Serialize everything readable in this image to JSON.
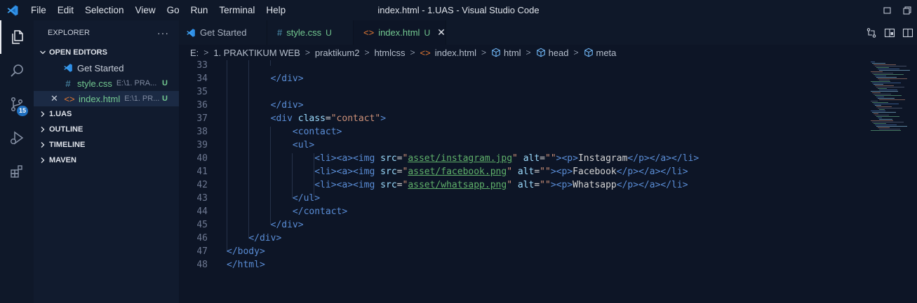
{
  "titlebar": {
    "menu": [
      "File",
      "Edit",
      "Selection",
      "View",
      "Go",
      "Run",
      "Terminal",
      "Help"
    ],
    "title": "index.html - 1.UAS - Visual Studio Code"
  },
  "activitybar": {
    "items": [
      "explorer",
      "search",
      "source-control",
      "run-debug",
      "extensions"
    ],
    "scm_badge": "15"
  },
  "sidebar": {
    "title": "EXPLORER",
    "more": "···",
    "open_editors_label": "OPEN EDITORS",
    "open_editors": [
      {
        "name": "Get Started",
        "path": "",
        "status": ""
      },
      {
        "name": "style.css",
        "path": "E:\\1. PRA...",
        "status": "U"
      },
      {
        "name": "index.html",
        "path": "E:\\1. PR...",
        "status": "U"
      }
    ],
    "sections": [
      "1.UAS",
      "OUTLINE",
      "TIMELINE",
      "MAVEN"
    ]
  },
  "tabs": [
    {
      "label": "Get Started",
      "status": ""
    },
    {
      "label": "style.css",
      "status": "U"
    },
    {
      "label": "index.html",
      "status": "U"
    }
  ],
  "breadcrumbs": [
    "E:",
    "1. PRAKTIKUM WEB",
    "praktikum2",
    "htmlcss",
    "index.html",
    "html",
    "head",
    "meta"
  ],
  "editor": {
    "lines": [
      {
        "n": "33",
        "text": ""
      },
      {
        "n": "34",
        "text": "            </div>"
      },
      {
        "n": "35",
        "text": ""
      },
      {
        "n": "36",
        "text": "            </div>"
      },
      {
        "n": "37",
        "text": "            <div class=\"contact\">"
      },
      {
        "n": "38",
        "text": "                <contact>"
      },
      {
        "n": "39",
        "text": "                <ul>"
      },
      {
        "n": "40",
        "text": "                    <li><a><img src=\"asset/instagram.jpg\" alt=\"\"><p>Instagram</p></a></li>"
      },
      {
        "n": "41",
        "text": "                    <li><a><img src=\"asset/facebook.png\" alt=\"\"><p>Facebook</p></a></li>"
      },
      {
        "n": "42",
        "text": "                    <li><a><img src=\"asset/whatsapp.png\" alt=\"\"><p>Whatsapp</p></a></li>"
      },
      {
        "n": "43",
        "text": "                </ul>"
      },
      {
        "n": "44",
        "text": "                </contact>"
      },
      {
        "n": "45",
        "text": "            </div>"
      },
      {
        "n": "46",
        "text": "        </div>"
      },
      {
        "n": "47",
        "text": "    </body>"
      },
      {
        "n": "48",
        "text": "    </html>"
      }
    ]
  },
  "colors": {
    "background": "#0d1526",
    "tag": "#5a8dd6",
    "attribute": "#9cdcfe",
    "string": "#ce9178",
    "untracked": "#73c991"
  }
}
